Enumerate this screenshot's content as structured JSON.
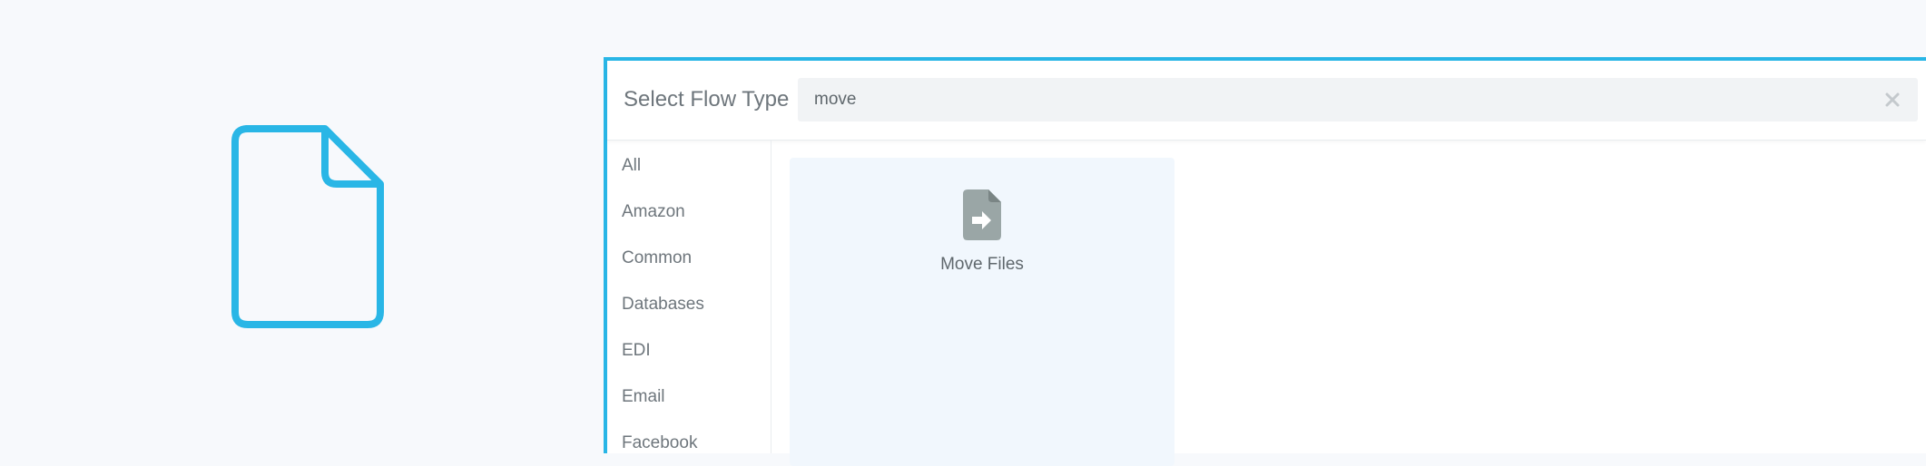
{
  "dialog": {
    "title": "Select Flow Type",
    "search": {
      "value": "move",
      "placeholder": ""
    }
  },
  "sidebar": {
    "items": [
      {
        "label": "All"
      },
      {
        "label": "Amazon"
      },
      {
        "label": "Common"
      },
      {
        "label": "Databases"
      },
      {
        "label": "EDI"
      },
      {
        "label": "Email"
      },
      {
        "label": "Facebook"
      }
    ]
  },
  "results": [
    {
      "label": "Move Files",
      "icon": "move-file-icon"
    }
  ],
  "colors": {
    "accent": "#29b6e6",
    "background": "#f7f9fc",
    "card_background": "#f1f7fd",
    "icon_gray": "#9aa6a6"
  }
}
